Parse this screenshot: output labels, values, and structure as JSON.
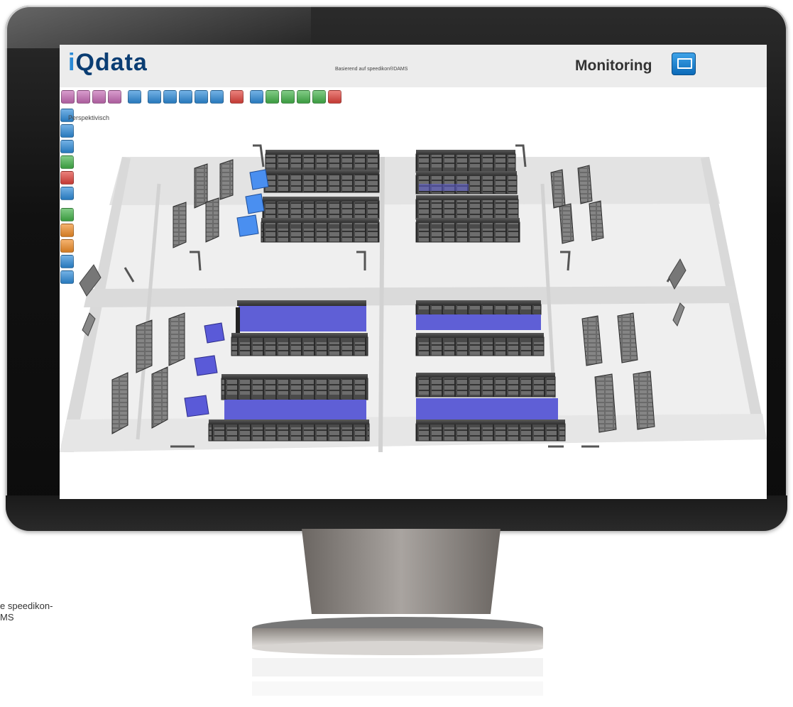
{
  "app": {
    "logo_prefix": "i",
    "logo_rest": "Qdata",
    "tagline": "Basierend auf speedikon®DAMS",
    "mode_title": "Monitoring",
    "view_label": "Perspektivisch"
  },
  "toolbar": {
    "items": [
      {
        "name": "zoom-in-icon",
        "color": "#c56bb4"
      },
      {
        "name": "zoom-out-icon",
        "color": "#c56bb4"
      },
      {
        "name": "pan-icon",
        "color": "#c56bb4"
      },
      {
        "name": "rotate-view-icon",
        "color": "#c56bb4"
      },
      {
        "name": "floor-plan-icon",
        "color": "#2e8bd8"
      },
      {
        "name": "rack-list-icon",
        "color": "#2e8bd8"
      },
      {
        "name": "rack-detail-icon",
        "color": "#2e8bd8"
      },
      {
        "name": "view-3d-icon",
        "color": "#2e8bd8"
      },
      {
        "name": "server-icon",
        "color": "#2e8bd8"
      },
      {
        "name": "monitor-icon",
        "color": "#2e8bd8"
      },
      {
        "name": "alarm-icon",
        "color": "#e0433c"
      },
      {
        "name": "cable-icon",
        "color": "#2e8bd8"
      },
      {
        "name": "layer-icon",
        "color": "#44b24a"
      },
      {
        "name": "info-icon",
        "color": "#44b24a"
      },
      {
        "name": "report-icon",
        "color": "#44b24a"
      },
      {
        "name": "flag-icon",
        "color": "#44b24a"
      },
      {
        "name": "export-icon",
        "color": "#e0433c"
      }
    ]
  },
  "sidebar": {
    "items": [
      {
        "name": "overview-icon",
        "color": "#2e8bd8"
      },
      {
        "name": "building-icon",
        "color": "#2e8bd8"
      },
      {
        "name": "network-icon",
        "color": "#2e8bd8"
      },
      {
        "name": "power-icon",
        "color": "#44b24a"
      },
      {
        "name": "temperature-icon",
        "color": "#e0433c"
      },
      {
        "name": "people-icon",
        "color": "#2e8bd8"
      },
      {
        "name": "table-icon",
        "color": "#44b24a"
      },
      {
        "name": "folder-icon",
        "color": "#f08d28"
      },
      {
        "name": "edit-icon",
        "color": "#f08d28"
      },
      {
        "name": "tools-icon",
        "color": "#2e8bd8"
      },
      {
        "name": "document-icon",
        "color": "#2e8bd8"
      }
    ]
  },
  "caption": {
    "line1": "e speedikon-",
    "line2": "MS"
  },
  "colors": {
    "accent_blue": "#2e8bd8",
    "logo_blue": "#0a3d73",
    "rack_dark": "#3c3c3c",
    "cold_aisle": "#5f5fd6",
    "crac_unit": "#4a8ff0"
  }
}
